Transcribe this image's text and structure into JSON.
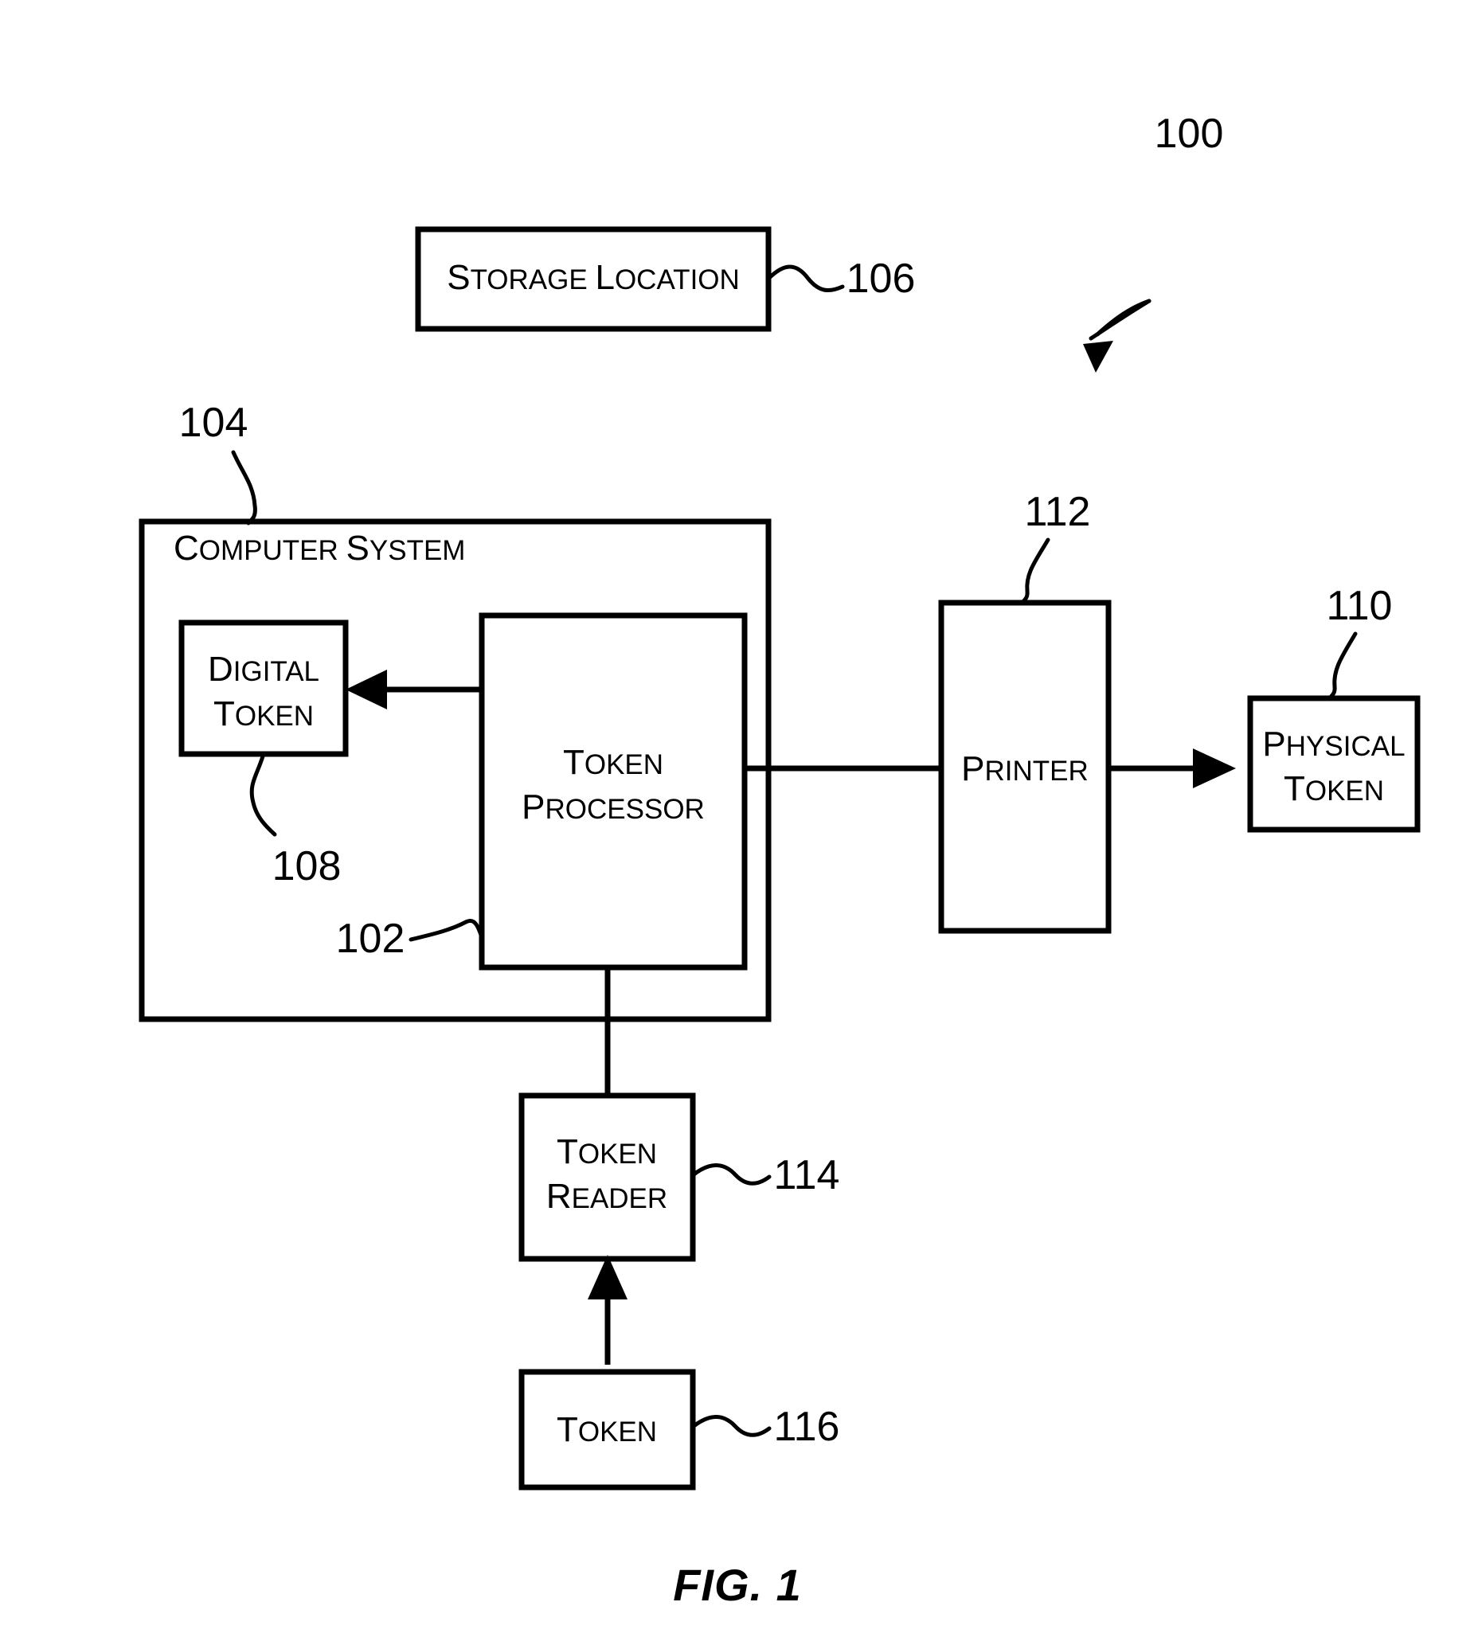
{
  "figure": {
    "caption": "FIG. 1",
    "system_ref": "100"
  },
  "blocks": {
    "storage_location": {
      "label_first": "S",
      "label_rest": "TORAGE ",
      "label_first2": "L",
      "label_rest2": "OCATION",
      "full_label": "STORAGE LOCATION",
      "ref": "106"
    },
    "computer_system": {
      "label_first": "C",
      "label_rest": "OMPUTER ",
      "label_first2": "S",
      "label_rest2": "YSTEM",
      "full_label": "COMPUTER SYSTEM",
      "ref": "104"
    },
    "digital_token": {
      "line1_first": "D",
      "line1_rest": "IGITAL",
      "line2_first": "T",
      "line2_rest": "OKEN",
      "full_label": "DIGITAL TOKEN",
      "ref": "108"
    },
    "token_processor": {
      "line1_first": "T",
      "line1_rest": "OKEN",
      "line2_first": "P",
      "line2_rest": "ROCESSOR",
      "full_label": "TOKEN PROCESSOR",
      "ref": "102"
    },
    "printer": {
      "label_first": "P",
      "label_rest": "RINTER",
      "full_label": "PRINTER",
      "ref": "112"
    },
    "physical_token": {
      "line1_first": "P",
      "line1_rest": "HYSICAL",
      "line2_first": "T",
      "line2_rest": "OKEN",
      "full_label": "PHYSICAL TOKEN",
      "ref": "110"
    },
    "token_reader": {
      "line1_first": "T",
      "line1_rest": "OKEN",
      "line2_first": "R",
      "line2_rest": "EADER",
      "full_label": "TOKEN READER",
      "ref": "114"
    },
    "token": {
      "label_first": "T",
      "label_rest": "OKEN",
      "full_label": "TOKEN",
      "ref": "116"
    }
  },
  "colors": {
    "stroke": "#000000",
    "background": "#ffffff"
  }
}
